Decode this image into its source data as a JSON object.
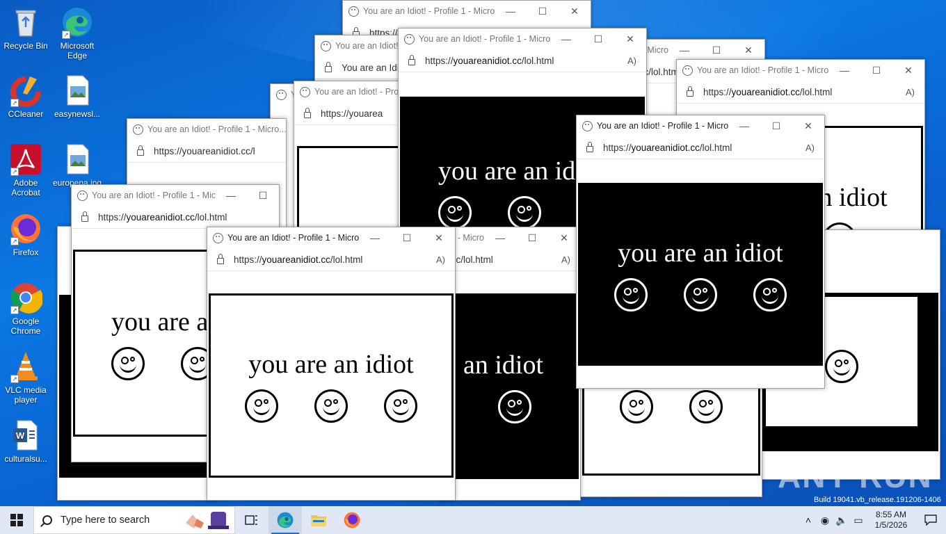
{
  "desktop_icons": [
    {
      "label": "Recycle Bin",
      "icon": "recycle-bin-icon"
    },
    {
      "label": "Microsoft Edge",
      "icon": "edge-icon"
    },
    {
      "label": "CCleaner",
      "icon": "ccleaner-icon"
    },
    {
      "label": "easynewsl...",
      "icon": "image-file-icon"
    },
    {
      "label": "Adobe Acrobat",
      "icon": "acrobat-icon"
    },
    {
      "label": "europena.jpg",
      "icon": "image-file-icon"
    },
    {
      "label": "Firefox",
      "icon": "firefox-icon"
    },
    {
      "label": "Google Chrome",
      "icon": "chrome-icon"
    },
    {
      "label": "VLC media player",
      "icon": "vlc-icon"
    },
    {
      "label": "culturalsu...",
      "icon": "word-document-icon"
    }
  ],
  "popup": {
    "title": "You are an Idiot! - Profile 1 - Micro...",
    "title_short": "You are an Idiot! - Profil",
    "url_prefix": "https://",
    "url_host": "youareanidiot.cc",
    "url_path": "/lol.html",
    "url_partial": "https://youareanidiot.cc/l",
    "url_partial2": "https://youarea",
    "url_tail": ".cc/lol.html",
    "message": "you are an idiot",
    "message_partial": "you are a",
    "message_tail": "an idiot",
    "controls": {
      "minimize": "—",
      "maximize": "☐",
      "close": "✕"
    },
    "reader_icon": "A)"
  },
  "taskbar": {
    "search_placeholder": "Type here to search",
    "apps": [
      "task-view",
      "edge",
      "file-explorer",
      "firefox"
    ],
    "active_app": "edge",
    "time": "8:55 AM",
    "date": "1/5/2026"
  },
  "watermark": "ANY RUN",
  "build_text": "Build 19041.vb_release.191206-1406",
  "colors": {
    "accent": "#1a6fd0",
    "desktop": "#0b78e3",
    "panel_black": "#000000",
    "panel_white": "#ffffff"
  }
}
